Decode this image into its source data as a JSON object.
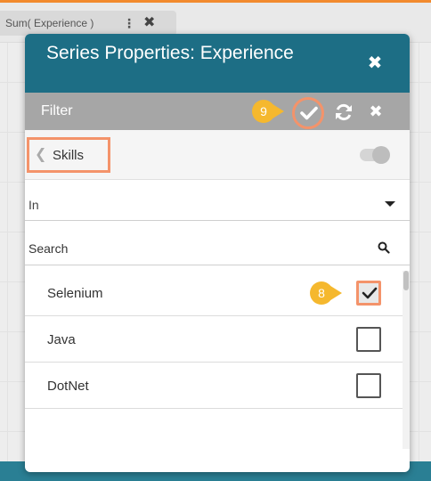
{
  "background": {
    "tab_label": "Sum( Experience )",
    "kebab_icon": "kebab-icon",
    "close_icon": "close-icon"
  },
  "panel": {
    "title": "Series Properties: Experience",
    "close_icon": "close-icon"
  },
  "filter_bar": {
    "label": "Filter",
    "apply_icon": "checkmark-icon",
    "refresh_icon": "refresh-icon",
    "close_icon": "close-icon"
  },
  "callouts": {
    "apply": "9",
    "checkbox": "8"
  },
  "skills": {
    "back_label": "Skills",
    "chevron_icon": "chevron-left-icon",
    "toggle_icon": "toggle-icon"
  },
  "operator_select": {
    "value": "In",
    "caret_icon": "caret-down-icon"
  },
  "search": {
    "placeholder": "Search",
    "icon": "search-icon"
  },
  "items": [
    {
      "label": "Selenium",
      "checked": true
    },
    {
      "label": "Java",
      "checked": false
    },
    {
      "label": "DotNet",
      "checked": false
    }
  ],
  "colors": {
    "header": "#1d6e85",
    "filter_bar": "#a6a6a6",
    "highlight": "#f4936a",
    "callout": "#f5b82e"
  }
}
